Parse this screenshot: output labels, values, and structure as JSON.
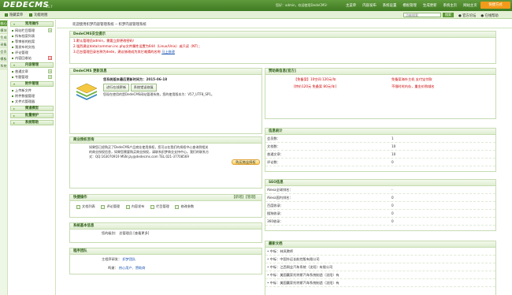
{
  "top": {
    "logo": "DEDECMS",
    "logo_version": "v5.7",
    "user_info": "您好：admin，欢迎使用DedeCMS！",
    "nav": [
      "主菜单",
      "内容发布",
      "系统设置",
      "模板管理",
      "生成更新",
      "系统主页",
      "网站主页",
      "会员中心",
      "注销"
    ],
    "quick_menu": "快捷方式"
  },
  "subbar": {
    "links": [
      "隐藏菜单",
      "功能地图"
    ],
    "welcome": "欢迎使用专业的PHP网站管理系统，轻松建站的首选利器 -- 织梦内容管理系统",
    "search_placeholder": "功能搜索",
    "search_button": "搜索",
    "right_links": [
      "官方论坛",
      "在线帮助"
    ]
  },
  "vtabs": [
    "核心",
    "模块",
    "生成",
    "采集",
    "会员",
    "模板",
    "系统"
  ],
  "sidebar": {
    "sections": [
      {
        "title": "常用操作",
        "items": [
          {
            "label": "网站栏目管理",
            "mark": "+"
          },
          {
            "label": "所有档案列表",
            "mark": ""
          },
          {
            "label": "等审核的档案",
            "mark": ""
          },
          {
            "label": "我发布的文档",
            "mark": ""
          },
          {
            "label": "评论管理",
            "mark": ""
          },
          {
            "label": "内容回收站",
            "mark": "x"
          }
        ]
      },
      {
        "title": "内容管理",
        "items": [
          {
            "label": "普通文章",
            "mark": "+"
          },
          {
            "label": "专题管理",
            "mark": "+"
          }
        ]
      },
      {
        "title": "附件管理",
        "items": [
          {
            "label": "上传新文件",
            "mark": ""
          },
          {
            "label": "附件数据管理",
            "mark": ""
          },
          {
            "label": "文件式管理器",
            "mark": ""
          }
        ]
      },
      {
        "title": "频道模型",
        "items": []
      },
      {
        "title": "批量维护",
        "items": []
      },
      {
        "title": "系统帮助",
        "items": []
      }
    ]
  },
  "main": {
    "tab_title": "欢迎使用织梦内容管理系统 -- 织梦内容管理系统",
    "security": {
      "title": "DedeCMS安全提示",
      "lines": [
        "1.默认管理员admin，需要立即更改密码！",
        "2.强烈建议data/common.inc.php文件属性设置为644（Linux/Unix）或只读（NT）；",
        "3.后台管理目录名称为dede，建议修改成为其它难猜的名称"
      ],
      "link": "马上修改"
    },
    "update": {
      "title": "DedeCMS 更新消息",
      "line1": "您系统版本最后更新时间为：2015-06-18",
      "btn1": "进行在线更新",
      "btn2": "系统错误修复",
      "line2": "您现在使用的是DedeCMS网站管理系统，您的使用版本为：V57_UTF8_SP1。"
    },
    "business": {
      "title": "商业授权咨询",
      "text": "如果您已经购买了DedeCMS产品商业使用授权，您可以在我们的授权中心查询到相关的商业授权信息，如果您需要购买商业授权，请联系织梦商业支持中心。我们的联系方式：QQ:163070919 MSN jzy@dedecms.com TEL:021-37708569",
      "button": "购买商业授权"
    },
    "quick": {
      "title": "快捷操作",
      "right": "【新增】【管理】",
      "items": [
        "文档列表",
        "评论管理",
        "内容发布",
        "栏目管理",
        "修改参数"
      ]
    },
    "sysinfo": {
      "title": "系统基本信息",
      "label": "您的级别：",
      "value": "总管理员 [查看更多]"
    },
    "team": {
      "title": "程序团队",
      "rows": [
        {
          "k": "主程序研发：",
          "v": "织梦团队"
        },
        {
          "k": "鸣谢：",
          "v": "热心用户、赞助商"
        }
      ]
    },
    "dede_info": {
      "title": "赞助商信息[官方]",
      "items": [
        "【免备案】10空间 120元/年",
        "免备案海外主机 支付宝付款",
        "[特价120元 免备案 80元/年]",
        "不限时时内存，重金价购域名"
      ]
    },
    "stats": {
      "title": "信息统计",
      "rows": [
        {
          "k": "会员数：",
          "v": "1"
        },
        {
          "k": "文档数：",
          "v": "10"
        },
        {
          "k": "普通文章：",
          "v": "10"
        },
        {
          "k": "评论数：",
          "v": "0"
        }
      ]
    },
    "seo": {
      "title": "SEO信息",
      "rows": [
        {
          "k": "Alexa全球排名：",
          "v": "-"
        },
        {
          "k": "Alexa国内排名：",
          "v": "0"
        },
        {
          "k": "百度收录：",
          "v": "0"
        },
        {
          "k": "搜狗收录：",
          "v": "0"
        },
        {
          "k": "360收录：",
          "v": "0"
        }
      ]
    },
    "news": {
      "title": "最新文档",
      "items": [
        "• 中标：林凤教师",
        "• 中标：中国外运长航控股有限公司",
        "• 中标：江西铜业汽车系统（沈阳）有限公司",
        "• 中标：美国赢家托特斯汽车系统制造（沈阳）有",
        "• 中标：美国赢家托特斯汽车系统制造（沈阳）有"
      ]
    }
  }
}
